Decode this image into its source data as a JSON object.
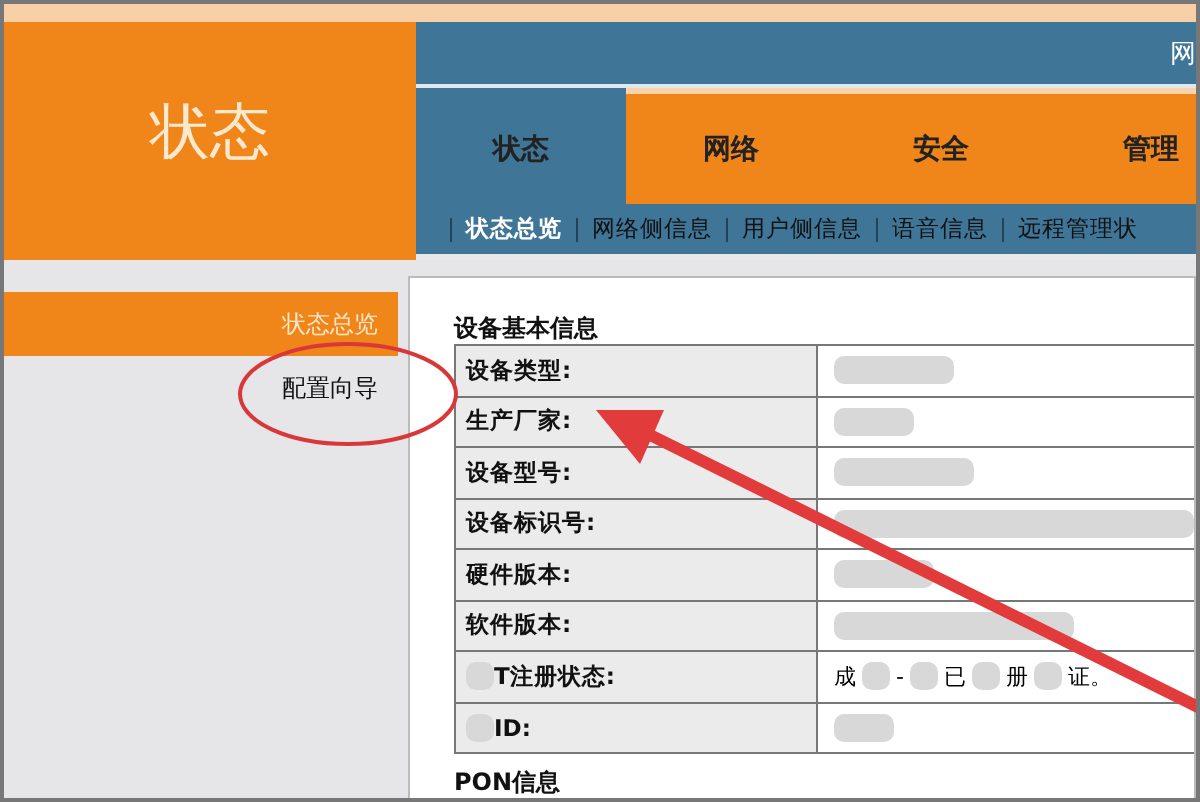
{
  "header": {
    "section_title": "状态",
    "top_bar_text": "网"
  },
  "tabs": [
    {
      "label": "状态",
      "selected": true
    },
    {
      "label": "网络",
      "selected": false
    },
    {
      "label": "安全",
      "selected": false
    },
    {
      "label": "管理",
      "selected": false
    }
  ],
  "subnav": [
    {
      "label": "状态总览",
      "selected": true
    },
    {
      "label": "网络侧信息",
      "selected": false
    },
    {
      "label": "用户侧信息",
      "selected": false
    },
    {
      "label": "语音信息",
      "selected": false
    },
    {
      "label": "远程管理状",
      "selected": false
    }
  ],
  "sidebar": {
    "items": [
      {
        "label": "状态总览",
        "selected": true
      },
      {
        "label": "配置向导",
        "selected": false
      }
    ]
  },
  "content": {
    "title": "设备基本信息",
    "rows": [
      {
        "label": "设备类型:",
        "label_blurred": false
      },
      {
        "label": "生产厂家:",
        "label_blurred": false
      },
      {
        "label": "设备型号:",
        "label_blurred": false
      },
      {
        "label": "设备标识号:",
        "label_blurred": false
      },
      {
        "label": "硬件版本:",
        "label_blurred": false
      },
      {
        "label": "软件版本:",
        "label_blurred": false
      },
      {
        "label": "T注册状态:",
        "label_blurred": true,
        "value_fragments": [
          "成",
          "-",
          "已",
          "册",
          "证。"
        ]
      },
      {
        "label": "ID:",
        "label_blurred": true
      }
    ],
    "next_section_title": "PON信息"
  }
}
